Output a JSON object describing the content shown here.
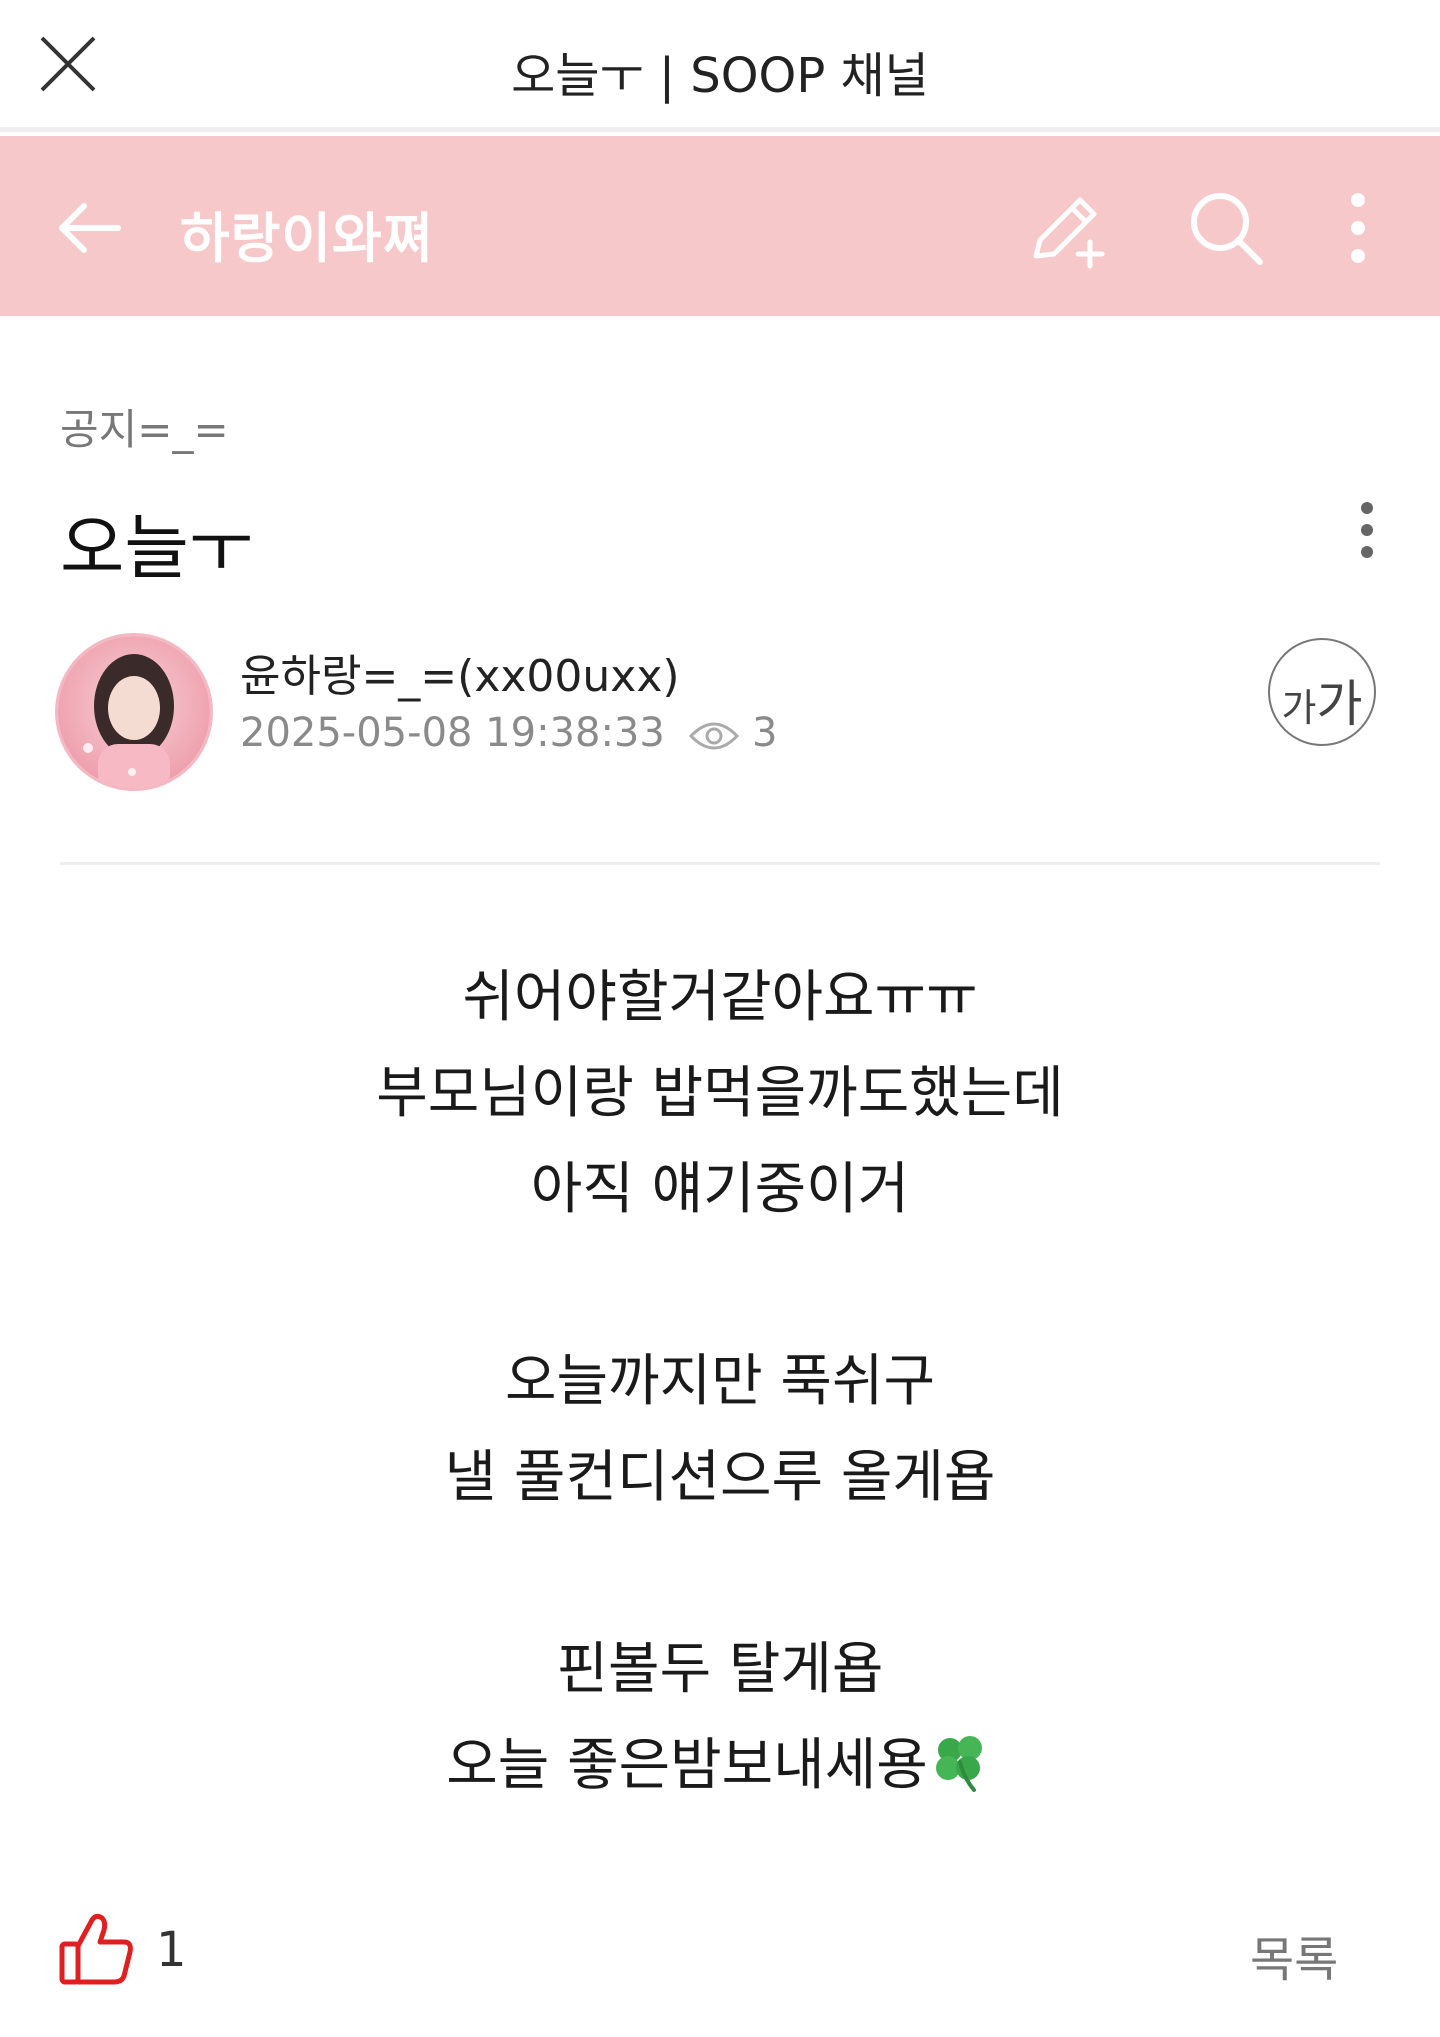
{
  "window": {
    "title": "오늘ㅜ | SOOP 채널"
  },
  "channel": {
    "name": "하랑이와쪄",
    "accent_color": "#f7c8c9"
  },
  "post": {
    "category": "공지=_=",
    "title": "오늘ㅜ",
    "author": "윤하랑=_=(xx00uxx)",
    "datetime": "2025-05-08 19:38:33",
    "views": "3",
    "font_button": {
      "small": "가",
      "large": "가"
    },
    "body": [
      "쉬어야할거같아요ㅠㅠ",
      "부모님이랑 밥먹을까도했는데",
      "아직 얘기중이거",
      "오늘까지만 푹쉬구",
      "낼 풀컨디션으루 올게욥",
      "핀볼두 탈게욥",
      "오늘 좋은밤보내세용"
    ],
    "likes": "1",
    "list_label": "목록"
  }
}
